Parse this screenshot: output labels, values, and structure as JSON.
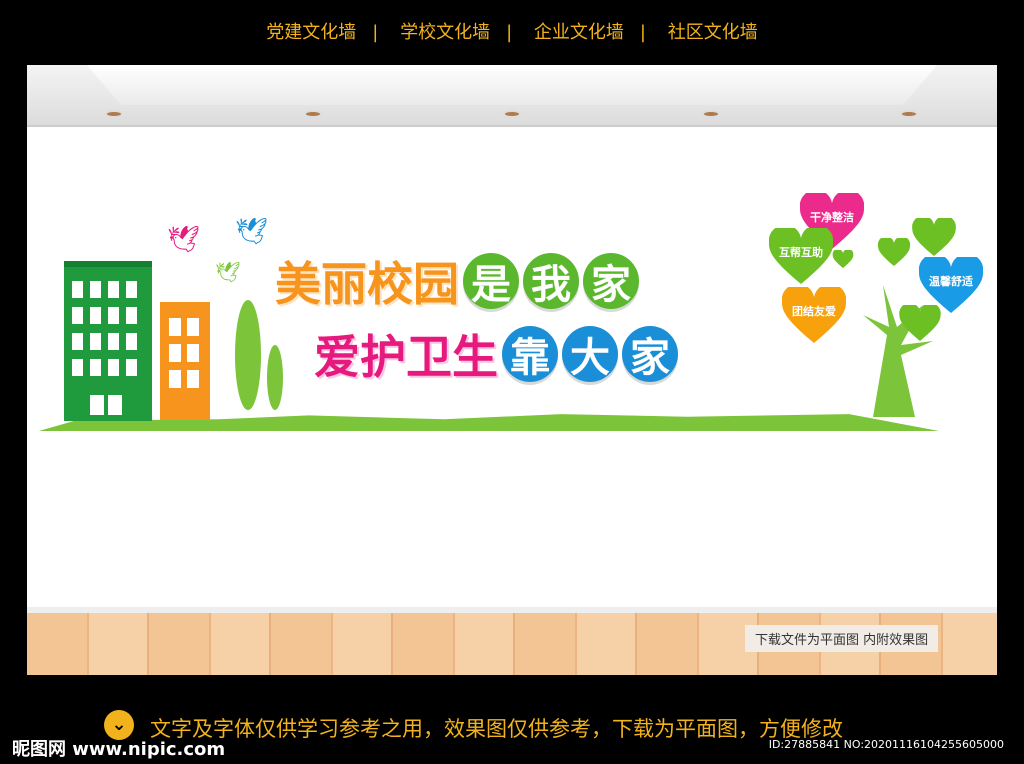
{
  "nav": [
    "党建文化墙",
    "学校文化墙",
    "企业文化墙",
    "社区文化墙"
  ],
  "nav_sep": "|",
  "title_line1": {
    "plain": "美丽校园",
    "circles": [
      "是",
      "我",
      "家"
    ],
    "plain_color": "#f7941d",
    "circle_color": "#5bb82e"
  },
  "title_line2": {
    "plain": "爱护卫生",
    "circles": [
      "靠",
      "大",
      "家"
    ],
    "plain_color": "#e6197f",
    "circle_color": "#1a8fd8"
  },
  "hearts": [
    {
      "label": "干净整洁",
      "color": "#ec2a8c"
    },
    {
      "label": "互帮互助",
      "color": "#6cc024"
    },
    {
      "label": "团结友爱",
      "color": "#f7a10c"
    },
    {
      "label": "温馨舒适",
      "color": "#1a9be6"
    }
  ],
  "tag": "下载文件为平面图  内附效果图",
  "footer": {
    "badge": "⌄",
    "text": "文字及字体仅供学习参考之用，效果图仅供参考，下载为平面图，方便修改",
    "logo": "昵图网 www.nipic.com",
    "id": "ID:27885841 NO:20201116104255605000"
  }
}
